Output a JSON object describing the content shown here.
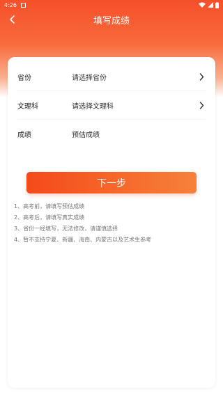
{
  "status_bar": {
    "time": "4:26"
  },
  "nav": {
    "title": "填写成绩"
  },
  "form": {
    "rows": [
      {
        "label": "省份",
        "value": "请选择省份"
      },
      {
        "label": "文理科",
        "value": "请选择文理科"
      },
      {
        "label": "成绩",
        "value": "预估成绩"
      }
    ]
  },
  "actions": {
    "next_label": "下一步"
  },
  "notes": [
    "1、高考前，请填写预估成绩",
    "2、高考后，请填写真实成绩",
    "3、省份一经填写，无法修改，请谨慎选择",
    "4、暂不支持宁夏、新疆、海南、内蒙古以及艺术生参考"
  ],
  "colors": {
    "accent_start": "#f54a1a",
    "accent_end": "#f6813a"
  }
}
